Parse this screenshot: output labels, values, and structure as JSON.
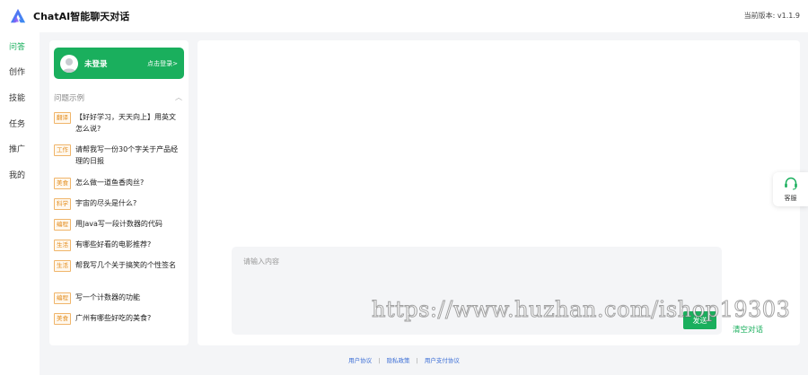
{
  "header": {
    "app_title": "ChatAI智能聊天对话",
    "version_text": "当前版本: v1.1.9",
    "logo_icon": "logo-icon"
  },
  "leftnav": {
    "items": [
      {
        "label": "问答",
        "active": true
      },
      {
        "label": "创作",
        "active": false
      },
      {
        "label": "技能",
        "active": false
      },
      {
        "label": "任务",
        "active": false
      },
      {
        "label": "推广",
        "active": false
      },
      {
        "label": "我的",
        "active": false
      }
    ]
  },
  "login": {
    "name": "未登录",
    "link": "点击登录>",
    "avatar_icon": "user-avatar-icon"
  },
  "examples": {
    "title": "问题示例",
    "chevron_icon": "chevron-up-icon",
    "items": [
      {
        "tag": "翻译",
        "text": "【好好学习，天天向上】用英文怎么说?"
      },
      {
        "tag": "工作",
        "text": "请帮我写一份30个字关于产品经理的日报"
      },
      {
        "tag": "美食",
        "text": "怎么做一道鱼香肉丝?"
      },
      {
        "tag": "科学",
        "text": "宇宙的尽头是什么?"
      },
      {
        "tag": "编程",
        "text": "用Java写一段计数器的代码"
      },
      {
        "tag": "生活",
        "text": "有哪些好看的电影推荐?"
      },
      {
        "tag": "生活",
        "text": "帮我写几个关于搞笑的个性签名"
      },
      {
        "tag": "编程",
        "text": "写一个计数器的功能"
      },
      {
        "tag": "美食",
        "text": "广州有哪些好吃的美食?"
      }
    ]
  },
  "chat": {
    "input_placeholder": "请输入内容",
    "input_value": "",
    "send_label": "发送",
    "clear_label": "清空对话"
  },
  "service": {
    "label": "客服",
    "icon": "headset-icon"
  },
  "footer": {
    "links": [
      "用户协议",
      "隐私政策",
      "用户支付协议"
    ],
    "separator": "|"
  },
  "watermark": "https://www.huzhan.com/ishop19303",
  "colors": {
    "accent": "#1aaf5d",
    "tag": "#e38b1b",
    "footer_link": "#3d6fd6",
    "background": "#f4f5f7"
  }
}
